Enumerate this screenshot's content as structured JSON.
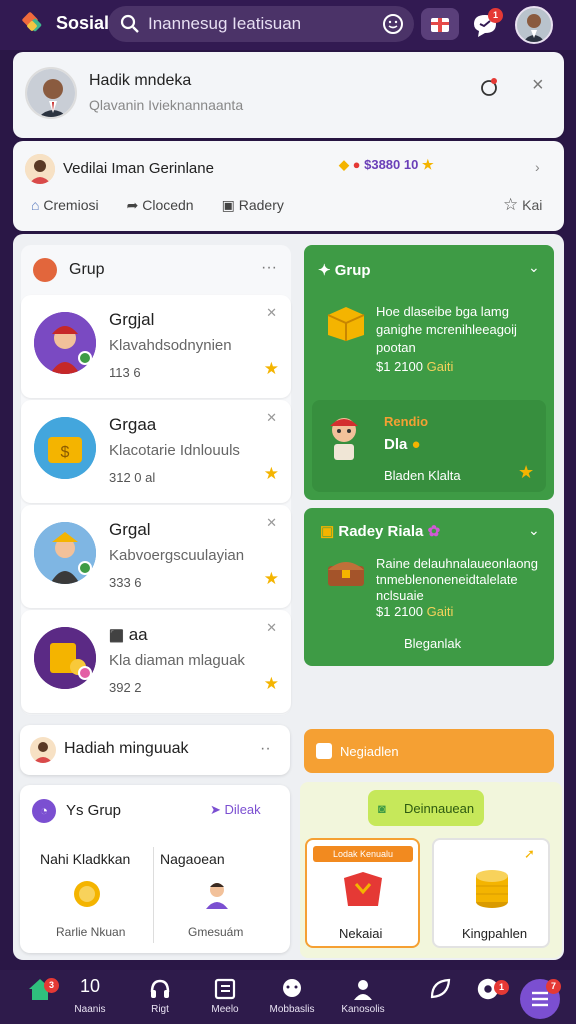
{
  "app": {
    "name": "Sosial"
  },
  "search": {
    "value": "Inannesug Ieatisuan"
  },
  "topbar": {
    "chat_badge": "1"
  },
  "profile": {
    "name": "Hadik mndeka",
    "subtitle": "Qlavanin Ivieknannaanta"
  },
  "notif": {
    "title": "Vedilai Iman Gerinlane",
    "score": "$3880 10",
    "actions": [
      {
        "label": "Cremiosi",
        "icon": "home-icon"
      },
      {
        "label": "Clocedn",
        "icon": "share-icon"
      },
      {
        "label": "Radery",
        "icon": "card-icon"
      }
    ],
    "fav_label": "Kai"
  },
  "groups": {
    "title": "Grup",
    "items": [
      {
        "name": "Grgjal",
        "desc": "Klavahdsodnynien",
        "count": "113 6"
      },
      {
        "name": "Grgaa",
        "desc": "Klacotarie Idnlouuls",
        "count": "312 0 al"
      },
      {
        "name": "Grgal",
        "desc": "Kabvoergscuulayian",
        "count": "333 6"
      },
      {
        "name": "aa",
        "desc": "Kla diaman mlaguak",
        "count": "392 2"
      }
    ]
  },
  "green1": {
    "title": "Grup",
    "text": "Hoe dlaseibe bga lamg ganighe mcrenihleeagoij pootan",
    "price": "$1 2100",
    "price_tag": "Gaiti",
    "inner_title": "Rendio",
    "inner_label": "Dla",
    "inner_footer": "Bladen Klalta"
  },
  "green2": {
    "title": "Radey Riala",
    "text": "Raine delauhnalaueonlaong tnmeblenoneneidtalelate nclsuaie",
    "price": "$1 2100",
    "price_tag": "Gaiti",
    "footer": "Bleganlak"
  },
  "hadiah": {
    "title": "Hadiah minguuak"
  },
  "orange": {
    "label": "Negiadlen"
  },
  "ysgroup": {
    "title": "Ys Grup",
    "link": "Dileak",
    "col1_title": "Nahi Kladkkan",
    "col1_sub": "Rarlie Nkuan",
    "col2_title": "Nagaoean",
    "col2_sub": "Gmesuám"
  },
  "rewards": {
    "button": "Deinnauean",
    "card1_banner": "Lodak Kenualu",
    "card1_label": "Nekaiai",
    "card2_label": "Kingpahlen"
  },
  "tabs": [
    {
      "label": "Naanis",
      "badge": "3"
    },
    {
      "label": "Rigt"
    },
    {
      "label": "Meelo"
    },
    {
      "label": "Mobbaslis"
    },
    {
      "label": "Kanosolis"
    },
    {
      "label": ""
    },
    {
      "label": "",
      "badge": "1"
    },
    {
      "label": "",
      "badge": "7"
    }
  ],
  "tab_extra": {
    "counter": "10"
  },
  "colors": {
    "primary": "#321a52",
    "green": "#3e9b45",
    "orange": "#f5a033",
    "accent_purple": "#7b4fd1"
  }
}
